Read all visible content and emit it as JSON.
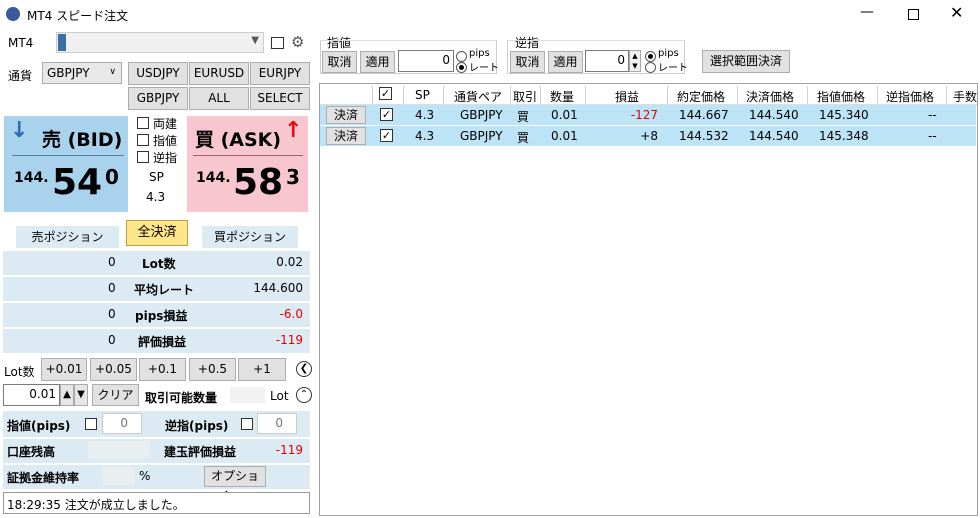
{
  "window": {
    "title": "MT4 スピード注文"
  },
  "top": {
    "platform_label": "MT4",
    "currency_label": "通貨",
    "currency_value": "GBPJPY"
  },
  "pairs": [
    "USDJPY",
    "EURUSD",
    "EURJPY",
    "GBPJPY",
    "ALL",
    "SELECT"
  ],
  "bid": {
    "label": "売 (BID)",
    "prefix": "144.",
    "main": "54",
    "sub": "0"
  },
  "ask": {
    "label": "買 (ASK)",
    "prefix": "144.",
    "main": "58",
    "sub": "3"
  },
  "middle": {
    "ryodate": "両建",
    "sashine": "指値",
    "gyakusashi": "逆指",
    "sp_label": "SP",
    "sp_value": "4.3"
  },
  "position": {
    "sell_tab": "売ポジション",
    "close_all": "全決済",
    "buy_tab": "買ポジション"
  },
  "stats": [
    {
      "left": "0",
      "label": "Lot数",
      "right": "0.02",
      "red": false
    },
    {
      "left": "0",
      "label": "平均レート",
      "right": "144.600",
      "red": false
    },
    {
      "left": "0",
      "label": "pips損益",
      "right": "-6.0",
      "red": true
    },
    {
      "left": "0",
      "label": "評価損益",
      "right": "-119",
      "red": true
    }
  ],
  "lot": {
    "label": "Lot数",
    "increments": [
      "+0.01",
      "+0.05",
      "+0.1",
      "+0.5",
      "+1"
    ],
    "value": "0.01",
    "clear": "クリア",
    "available_label": "取引可能数量",
    "unit": "Lot"
  },
  "bottom": {
    "limit_label": "指値(pips)",
    "limit_value": "0",
    "stop_label": "逆指(pips)",
    "stop_value": "0",
    "balance_label": "口座残高",
    "open_pl_label": "建玉評価損益",
    "open_pl_value": "-119",
    "margin_label": "証拠金維持率",
    "margin_unit": "%",
    "options_button": "オプション...",
    "status": "18:29:35 注文が成立しました。"
  },
  "right_toolbar": {
    "limit_group": "指値",
    "stop_group": "逆指",
    "cancel": "取消",
    "apply": "適用",
    "limit_value": "0",
    "stop_value": "0",
    "radio_pips": "pips",
    "radio_rate": "レート",
    "close_selected": "選択範囲決済"
  },
  "table": {
    "headers": [
      "SP",
      "通貨ペア",
      "取引",
      "数量",
      "損益",
      "約定価格",
      "決済価格",
      "指値価格",
      "逆指価格",
      "手数"
    ],
    "action_label": "決済",
    "rows": [
      {
        "sp": "4.3",
        "pair": "GBPJPY",
        "side": "買",
        "qty": "0.01",
        "pl": "-127",
        "pl_red": true,
        "open": "144.667",
        "close": "144.540",
        "limit": "145.340",
        "stop": "--"
      },
      {
        "sp": "4.3",
        "pair": "GBPJPY",
        "side": "買",
        "qty": "0.01",
        "pl": "+8",
        "pl_red": false,
        "open": "144.532",
        "close": "144.540",
        "limit": "145.348",
        "stop": "--"
      }
    ]
  },
  "colors": {
    "bid_bg": "#a9d3ec",
    "ask_bg": "#f7c6cf",
    "row_bg": "#dceaf3",
    "grid_selected": "#bde3f7",
    "loss": "#e00000"
  }
}
